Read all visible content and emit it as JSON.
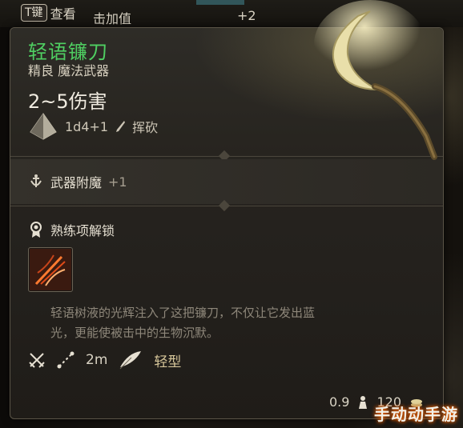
{
  "top_bar": {
    "key_badge": "T键",
    "hint_text": "查看",
    "value_label": "击加值",
    "value_plus": "+2"
  },
  "item": {
    "name": "轻语镰刀",
    "type": "精良 魔法武器",
    "damage": "2~5伤害",
    "dice": "1d4+1",
    "damage_type": "挥砍",
    "name_color": "#4fcf62"
  },
  "enchant": {
    "label": "武器附魔",
    "value": "+1"
  },
  "proficiency": {
    "label": "熟练项解锁"
  },
  "description": {
    "line1": "轻语树液的光辉注入了这把镰刀，不仅让它发出蓝",
    "line2": "光，更能使被击中的生物沉默。"
  },
  "properties": {
    "range": "2m",
    "weight_type": "轻型"
  },
  "footer": {
    "weight": "0.9",
    "price": "120"
  },
  "icons": [
    "dice-icon",
    "slash-icon",
    "enchant-icon",
    "proficiency-icon",
    "skill-icon",
    "crossed-swords-icon",
    "range-icon",
    "feather-icon",
    "weight-icon",
    "coin-icon"
  ],
  "watermark": "手动动手游"
}
